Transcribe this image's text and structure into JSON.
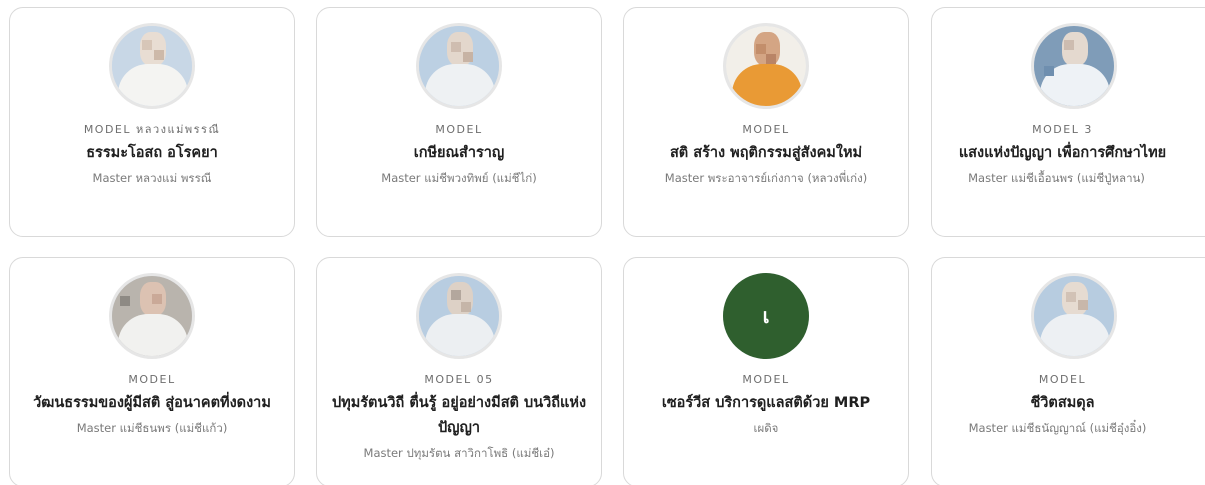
{
  "cards": [
    {
      "model_label": "MODEL หลวงแม่พรรณี",
      "title": "ธรรมะโอสถ อโรคยา",
      "master": "Master หลวงแม่ พรรณี",
      "avatar": "photo"
    },
    {
      "model_label": "MODEL",
      "title": "เกษียณสำราญ",
      "master": "Master แม่ชีพวงทิพย์ (แม่ชีไก่)",
      "avatar": "photo"
    },
    {
      "model_label": "MODEL",
      "title": "สติ สร้าง พฤติกรรมสู่สังคมใหม่",
      "master": "Master พระอาจารย์เก่งกาจ (หลวงพี่เก่ง)",
      "avatar": "photo-monk"
    },
    {
      "model_label": "MODEL 3",
      "title": "แสงแห่งปัญญา เพื่อการศึกษาไทย",
      "master": "Master แม่ชีเอื้อนพร (แม่ชีปู่หลาน)",
      "avatar": "photo"
    },
    {
      "model_label": "MODEL",
      "title": "วัฒนธรรมของผู้มีสติ สู่อนาคตที่งดงาม",
      "master": "Master แม่ชีธนพร (แม่ชีแก้ว)",
      "avatar": "photo"
    },
    {
      "model_label": "MODEL 05",
      "title": "ปทุมรัตนวิถี ตื่นรู้ อยู่อย่างมีสติ บนวิถีแห่งปัญญา",
      "master": "Master ปทุมรัตน สาวิกาโพธิ (แม่ชีเอ๋)",
      "avatar": "photo"
    },
    {
      "model_label": "MODEL",
      "title": "เซอร์วีส บริการดูแลสติด้วย MRP",
      "master": "เผดิจ",
      "avatar": "letter",
      "avatar_letter": "เ",
      "avatar_color": "#2f5f2e"
    },
    {
      "model_label": "MODEL",
      "title": "ชีวิตสมดุล",
      "master": "Master แม่ชีธนัญญาณ์ (แม่ชีอุ๋งอิ๋ง)",
      "avatar": "photo"
    }
  ],
  "colors": {
    "card_border": "#d9d9d9",
    "title_text": "#1f1f1f",
    "muted_text": "#7a7a7a",
    "letter_avatar_bg": "#2f5f2e"
  }
}
